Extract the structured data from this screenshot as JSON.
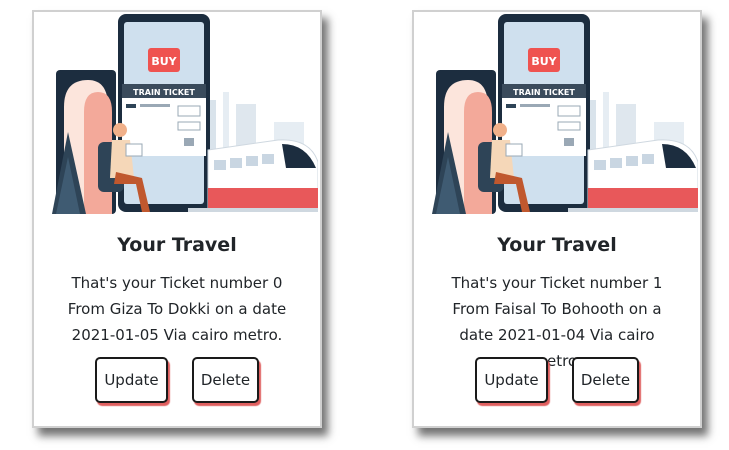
{
  "cards": [
    {
      "title": "Your Travel",
      "text": "That's your Ticket number 0 From Giza To Dokki on a date 2021-01-05 Via cairo metro.",
      "update_label": "Update",
      "delete_label": "Delete",
      "image": {
        "buy_label": "BUY",
        "ticket_label": "TRAIN TICKET"
      }
    },
    {
      "title": "Your Travel",
      "text": "That's your Ticket number 1 From Faisal To Bohooth on a date 2021-01-04 Via cairo metro.",
      "update_label": "Update",
      "delete_label": "Delete",
      "image": {
        "buy_label": "BUY",
        "ticket_label": "TRAIN TICKET"
      }
    }
  ],
  "colors": {
    "buy_red": "#ef5350",
    "phone_dark": "#1c2d3f",
    "train_red": "#e8585a",
    "button_shadow": "#e06060"
  }
}
